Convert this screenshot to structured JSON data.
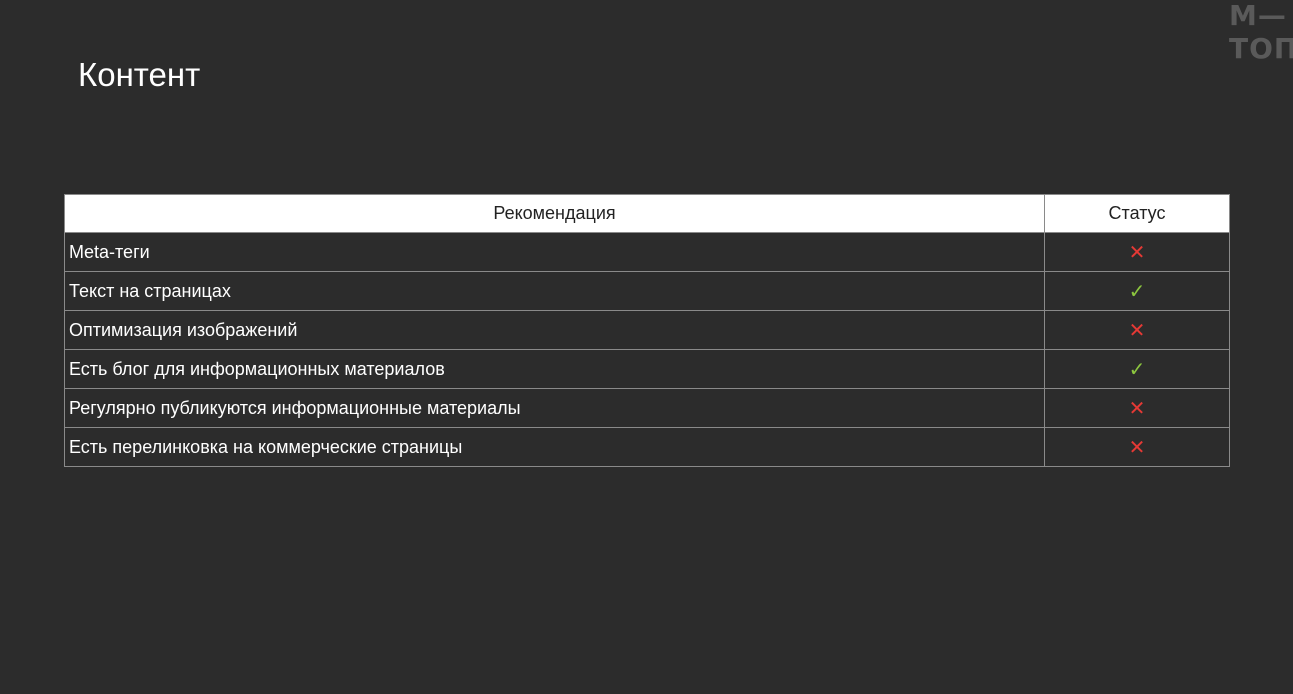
{
  "brand": {
    "logo_line1": "М—",
    "logo_line2": "ТОП",
    "color": "#5a5a5a"
  },
  "slide": {
    "title": "Контент"
  },
  "table": {
    "headers": {
      "recommendation": "Рекомендация",
      "status": "Статус"
    },
    "rows": [
      {
        "recommendation": "Meta-теги",
        "status": "✕",
        "status_kind": "fail"
      },
      {
        "recommendation": "Текст на страницах",
        "status": "✓",
        "status_kind": "ok"
      },
      {
        "recommendation": "Оптимизация изображений",
        "status": "✕",
        "status_kind": "fail"
      },
      {
        "recommendation": "Есть блог для информационных материалов",
        "status": "✓",
        "status_kind": "ok"
      },
      {
        "recommendation": "Регулярно публикуются информационные материалы",
        "status": "✕",
        "status_kind": "fail"
      },
      {
        "recommendation": "Есть перелинковка на коммерческие страницы",
        "status": "✕",
        "status_kind": "fail"
      }
    ]
  },
  "colors": {
    "background": "#2c2c2c",
    "ok": "#8cc63f",
    "fail": "#e53935",
    "header_bg": "#ffffff",
    "border": "#8a8a8a"
  }
}
